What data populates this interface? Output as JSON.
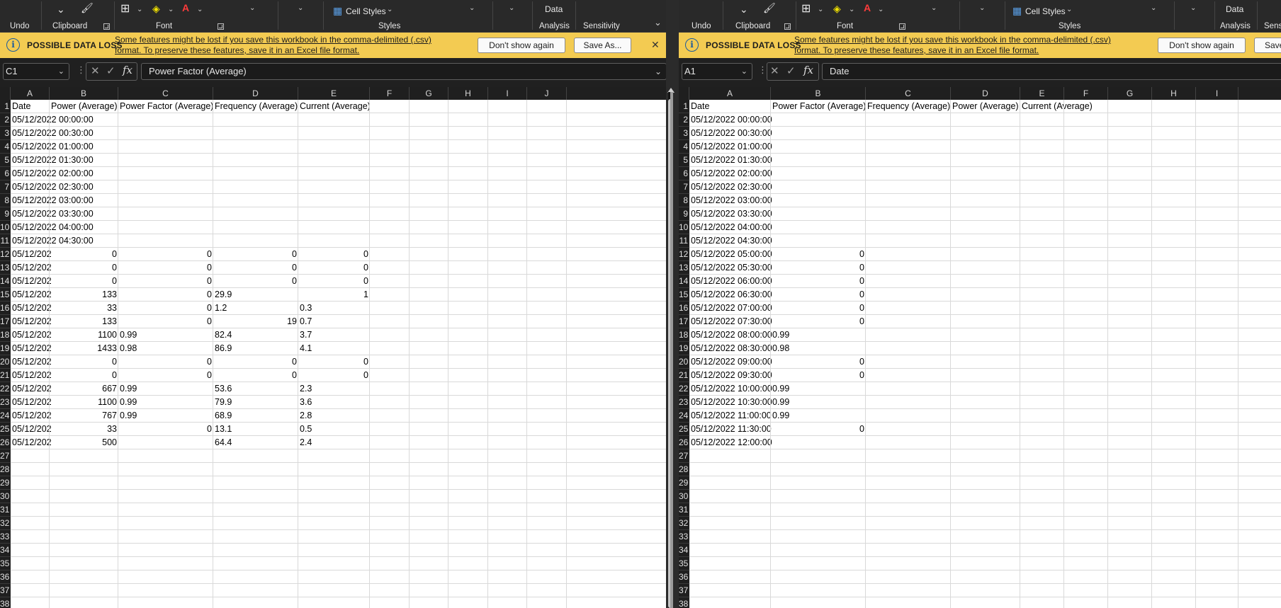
{
  "ribbon": {
    "undo_label": "Undo",
    "clipboard_label": "Clipboard",
    "font_label": "Font",
    "styles_label": "Styles",
    "analysis_label": "Analysis",
    "sensitivity_label": "Sensitivity",
    "cell_styles_label": "Cell Styles",
    "data_label": "Data",
    "icons": [
      "format-painter-icon",
      "borders-icon",
      "fill-color-icon",
      "font-color-icon",
      "cell-styles-icon",
      "dropdown-chevron-icon"
    ]
  },
  "message_bar": {
    "title": "POSSIBLE DATA LOSS",
    "line1": "Some features might be lost if you save this workbook in the comma-delimited (.csv)",
    "line2": "format. To preserve these features, save it in an Excel file format.",
    "dont_show_label": "Don't show again",
    "save_as_label": "Save As...",
    "right_save_label": "Save",
    "close_glyph": "✕",
    "info_glyph": "i",
    "color": "#f3cb52"
  },
  "left": {
    "name_box": "C1",
    "formula": "Power Factor (Average)",
    "columns": [
      "A",
      "B",
      "C",
      "D",
      "E",
      "F",
      "G",
      "H",
      "I",
      "J"
    ],
    "rows": [
      {
        "r": "1",
        "A": "Date",
        "B": "Power (Average)",
        "C": "Power Factor (Average)",
        "D": "Frequency (Average)",
        "E": "Current (Average)"
      },
      {
        "r": "2",
        "A": "05/12/2022 00:00:00"
      },
      {
        "r": "3",
        "A": "05/12/2022 00:30:00"
      },
      {
        "r": "4",
        "A": "05/12/2022 01:00:00"
      },
      {
        "r": "5",
        "A": "05/12/2022 01:30:00"
      },
      {
        "r": "6",
        "A": "05/12/2022 02:00:00"
      },
      {
        "r": "7",
        "A": "05/12/2022 02:30:00"
      },
      {
        "r": "8",
        "A": "05/12/2022 03:00:00"
      },
      {
        "r": "9",
        "A": "05/12/2022 03:30:00"
      },
      {
        "r": "10",
        "A": "05/12/2022 04:00:00"
      },
      {
        "r": "11",
        "A": "05/12/2022 04:30:00"
      },
      {
        "r": "12",
        "A": "05/12/202",
        "Bn": "0",
        "Cn": "0",
        "Dn": "0",
        "En": "0"
      },
      {
        "r": "13",
        "A": "05/12/202",
        "Bn": "0",
        "Cn": "0",
        "Dn": "0",
        "En": "0"
      },
      {
        "r": "14",
        "A": "05/12/202",
        "Bn": "0",
        "Cn": "0",
        "Dn": "0",
        "En": "0"
      },
      {
        "r": "15",
        "A": "05/12/202",
        "Bn": "133",
        "Cn": "0",
        "D": "29.9",
        "En": "1"
      },
      {
        "r": "16",
        "A": "05/12/202",
        "Bn": "33",
        "Cn": "0",
        "D": "1.2",
        "E": "0.3"
      },
      {
        "r": "17",
        "A": "05/12/202",
        "Bn": "133",
        "Cn": "0",
        "Dn": "19",
        "E": "0.7"
      },
      {
        "r": "18",
        "A": "05/12/202",
        "Bn": "1100",
        "C": "0.99",
        "D": "82.4",
        "E": "3.7"
      },
      {
        "r": "19",
        "A": "05/12/202",
        "Bn": "1433",
        "C": "0.98",
        "D": "86.9",
        "E": "4.1"
      },
      {
        "r": "20",
        "A": "05/12/202",
        "Bn": "0",
        "Cn": "0",
        "Dn": "0",
        "En": "0"
      },
      {
        "r": "21",
        "A": "05/12/202",
        "Bn": "0",
        "Cn": "0",
        "Dn": "0",
        "En": "0"
      },
      {
        "r": "22",
        "A": "05/12/202",
        "Bn": "667",
        "C": "0.99",
        "D": "53.6",
        "E": "2.3"
      },
      {
        "r": "23",
        "A": "05/12/202",
        "Bn": "1100",
        "C": "0.99",
        "D": "79.9",
        "E": "3.6"
      },
      {
        "r": "24",
        "A": "05/12/202",
        "Bn": "767",
        "C": "0.99",
        "D": "68.9",
        "E": "2.8"
      },
      {
        "r": "25",
        "A": "05/12/202",
        "Bn": "33",
        "Cn": "0",
        "D": "13.1",
        "E": "0.5"
      },
      {
        "r": "26",
        "A": "05/12/202",
        "Bn": "500",
        "D": "64.4",
        "E": "2.4"
      },
      {
        "r": "27"
      },
      {
        "r": "28"
      },
      {
        "r": "29"
      },
      {
        "r": "30"
      },
      {
        "r": "31"
      },
      {
        "r": "32"
      },
      {
        "r": "33"
      },
      {
        "r": "34"
      },
      {
        "r": "35"
      },
      {
        "r": "36"
      },
      {
        "r": "37"
      },
      {
        "r": "38"
      }
    ]
  },
  "right": {
    "name_box": "A1",
    "formula": "Date",
    "columns": [
      "A",
      "B",
      "C",
      "D",
      "E",
      "F",
      "G",
      "H",
      "I"
    ],
    "rows": [
      {
        "r": "1",
        "A": "Date",
        "B": "Power Factor (Average)",
        "C": "Frequency (Average)",
        "D": "Power (Average)",
        "E": "Current (Average)"
      },
      {
        "r": "2",
        "A": "05/12/2022 00:00:00"
      },
      {
        "r": "3",
        "A": "05/12/2022 00:30:00"
      },
      {
        "r": "4",
        "A": "05/12/2022 01:00:00"
      },
      {
        "r": "5",
        "A": "05/12/2022 01:30:00"
      },
      {
        "r": "6",
        "A": "05/12/2022 02:00:00"
      },
      {
        "r": "7",
        "A": "05/12/2022 02:30:00"
      },
      {
        "r": "8",
        "A": "05/12/2022 03:00:00"
      },
      {
        "r": "9",
        "A": "05/12/2022 03:30:00"
      },
      {
        "r": "10",
        "A": "05/12/2022 04:00:00"
      },
      {
        "r": "11",
        "A": "05/12/2022 04:30:00"
      },
      {
        "r": "12",
        "A": "05/12/2022 05:00:00",
        "Bn": "0"
      },
      {
        "r": "13",
        "A": "05/12/2022 05:30:00",
        "Bn": "0"
      },
      {
        "r": "14",
        "A": "05/12/2022 06:00:00",
        "Bn": "0"
      },
      {
        "r": "15",
        "A": "05/12/2022 06:30:00",
        "Bn": "0"
      },
      {
        "r": "16",
        "A": "05/12/2022 07:00:00",
        "Bn": "0"
      },
      {
        "r": "17",
        "A": "05/12/2022 07:30:00",
        "Bn": "0"
      },
      {
        "r": "18",
        "A": "05/12/2022 08:00:00",
        "B": "0.99"
      },
      {
        "r": "19",
        "A": "05/12/2022 08:30:00",
        "B": "0.98"
      },
      {
        "r": "20",
        "A": "05/12/2022 09:00:00",
        "Bn": "0"
      },
      {
        "r": "21",
        "A": "05/12/2022 09:30:00",
        "Bn": "0"
      },
      {
        "r": "22",
        "A": "05/12/2022 10:00:00",
        "B": "0.99"
      },
      {
        "r": "23",
        "A": "05/12/2022 10:30:00",
        "B": "0.99"
      },
      {
        "r": "24",
        "A": "05/12/2022 11:00:00",
        "B": "0.99"
      },
      {
        "r": "25",
        "A": "05/12/2022 11:30:00",
        "Bn": "0"
      },
      {
        "r": "26",
        "A": "05/12/2022 12:00:00"
      },
      {
        "r": "27"
      },
      {
        "r": "28"
      },
      {
        "r": "29"
      },
      {
        "r": "30"
      },
      {
        "r": "31"
      },
      {
        "r": "32"
      },
      {
        "r": "33"
      },
      {
        "r": "34"
      },
      {
        "r": "35"
      },
      {
        "r": "36"
      },
      {
        "r": "37"
      },
      {
        "r": "38"
      }
    ]
  }
}
